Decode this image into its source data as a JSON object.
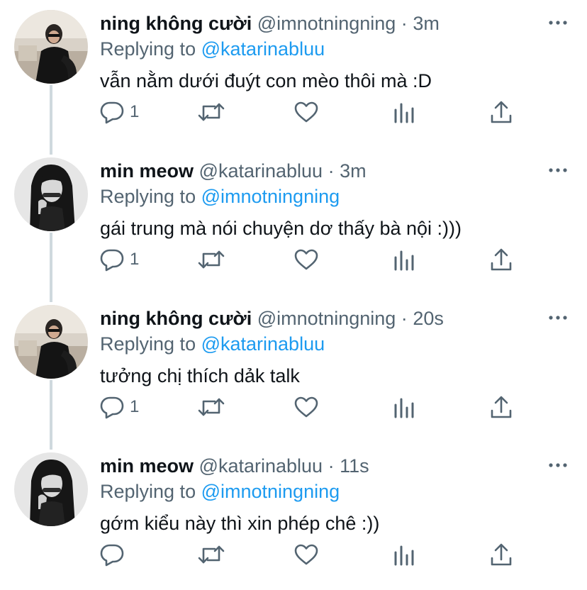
{
  "tweets": [
    {
      "name": "ning không cười",
      "handle": "@imnotningning",
      "dot": "·",
      "time": "3m",
      "replying_prefix": "Replying to ",
      "replying_to": "@katarinabluu",
      "text": "vẫn nằm dưới đuýt con mèo thôi mà :D",
      "reply_count": "1",
      "avatar": "photo-woman-black-dress"
    },
    {
      "name": "min meow",
      "handle": "@katarinabluu",
      "dot": "·",
      "time": "3m",
      "replying_prefix": "Replying to ",
      "replying_to": "@imnotningning",
      "text": "gái trung mà nói chuyện dơ thấy bà nội :)))",
      "reply_count": "1",
      "avatar": "photo-woman-monochrome"
    },
    {
      "name": "ning không cười",
      "handle": "@imnotningning",
      "dot": "·",
      "time": "20s",
      "replying_prefix": "Replying to ",
      "replying_to": "@katarinabluu",
      "text": "tưởng chị thích dảk talk",
      "reply_count": "1",
      "avatar": "photo-woman-black-dress"
    },
    {
      "name": "min meow",
      "handle": "@katarinabluu",
      "dot": "·",
      "time": "11s",
      "replying_prefix": "Replying to ",
      "replying_to": "@imnotningning",
      "text": "gớm kiểu này thì xin phép chê :))",
      "reply_count": "",
      "avatar": "photo-woman-monochrome"
    }
  ],
  "icons": {
    "more": "more-horizontal-icon",
    "reply": "reply-bubble-icon",
    "retweet": "retweet-icon",
    "like": "heart-icon",
    "stats": "analytics-icon",
    "share": "share-upload-icon"
  },
  "colors": {
    "text": "#0f1419",
    "secondary": "#536471",
    "mention": "#1d9bf0",
    "thread_line": "#cfd9de"
  }
}
